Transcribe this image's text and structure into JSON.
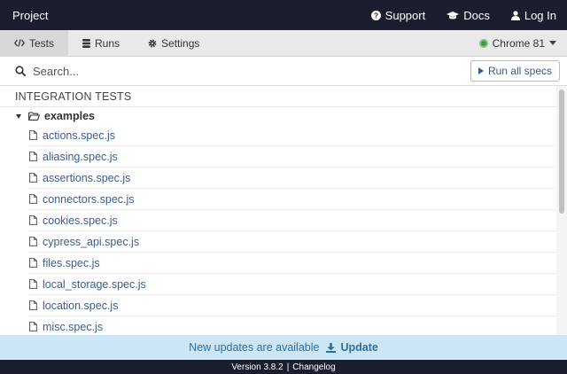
{
  "topbar": {
    "title": "Project",
    "links": [
      {
        "label": "Support",
        "icon": "question-circle-icon"
      },
      {
        "label": "Docs",
        "icon": "graduation-cap-icon"
      },
      {
        "label": "Log In",
        "icon": "user-icon"
      }
    ]
  },
  "tabs": [
    {
      "label": "Tests",
      "icon": "code-icon",
      "active": true
    },
    {
      "label": "Runs",
      "icon": "database-icon",
      "active": false
    },
    {
      "label": "Settings",
      "icon": "gear-icon",
      "active": false
    }
  ],
  "browser": {
    "label": "Chrome 81",
    "icon": "chrome-icon",
    "accent": "#3a9a4a"
  },
  "search": {
    "placeholder": "Search...",
    "value": ""
  },
  "run_all": {
    "label": "Run all specs"
  },
  "specs": {
    "section_title": "INTEGRATION TESTS",
    "folder": "examples",
    "files": [
      "actions.spec.js",
      "aliasing.spec.js",
      "assertions.spec.js",
      "connectors.spec.js",
      "cookies.spec.js",
      "cypress_api.spec.js",
      "files.spec.js",
      "local_storage.spec.js",
      "location.spec.js",
      "misc.spec.js"
    ]
  },
  "update_banner": {
    "message": "New updates are available",
    "action": "Update"
  },
  "footer": {
    "version": "Version 3.8.2",
    "changelog": "Changelog"
  },
  "colors": {
    "navbar": "#1b1e2e",
    "link": "#3b5d8e",
    "banner": "#cde6f5",
    "banner_text": "#2f6e9b"
  }
}
